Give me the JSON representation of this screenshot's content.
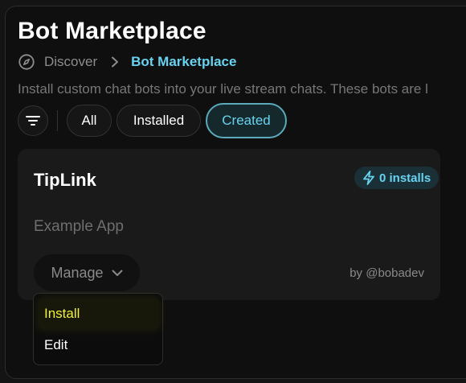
{
  "page": {
    "title": "Bot Marketplace",
    "description": "Install custom chat bots into your live stream chats. These bots are l"
  },
  "breadcrumb": {
    "items": [
      {
        "label": "Discover",
        "icon": "compass-icon"
      },
      {
        "label": "Bot Marketplace"
      }
    ]
  },
  "filters": {
    "icon": "filter-icon",
    "tabs": [
      {
        "label": "All",
        "active": false
      },
      {
        "label": "Installed",
        "active": false
      },
      {
        "label": "Created",
        "active": true
      }
    ]
  },
  "card": {
    "title": "TipLink",
    "badge": "0 installs",
    "badge_icon": "lightning-icon",
    "subtitle": "Example App",
    "manage_label": "Manage",
    "author": "by @bobadev"
  },
  "menu": {
    "items": [
      {
        "label": "Install",
        "highlighted": true
      },
      {
        "label": "Edit",
        "highlighted": false
      }
    ]
  },
  "colors": {
    "accent": "#67d3f0",
    "highlight": "#f2f23a",
    "background": "#0f0f0f"
  }
}
